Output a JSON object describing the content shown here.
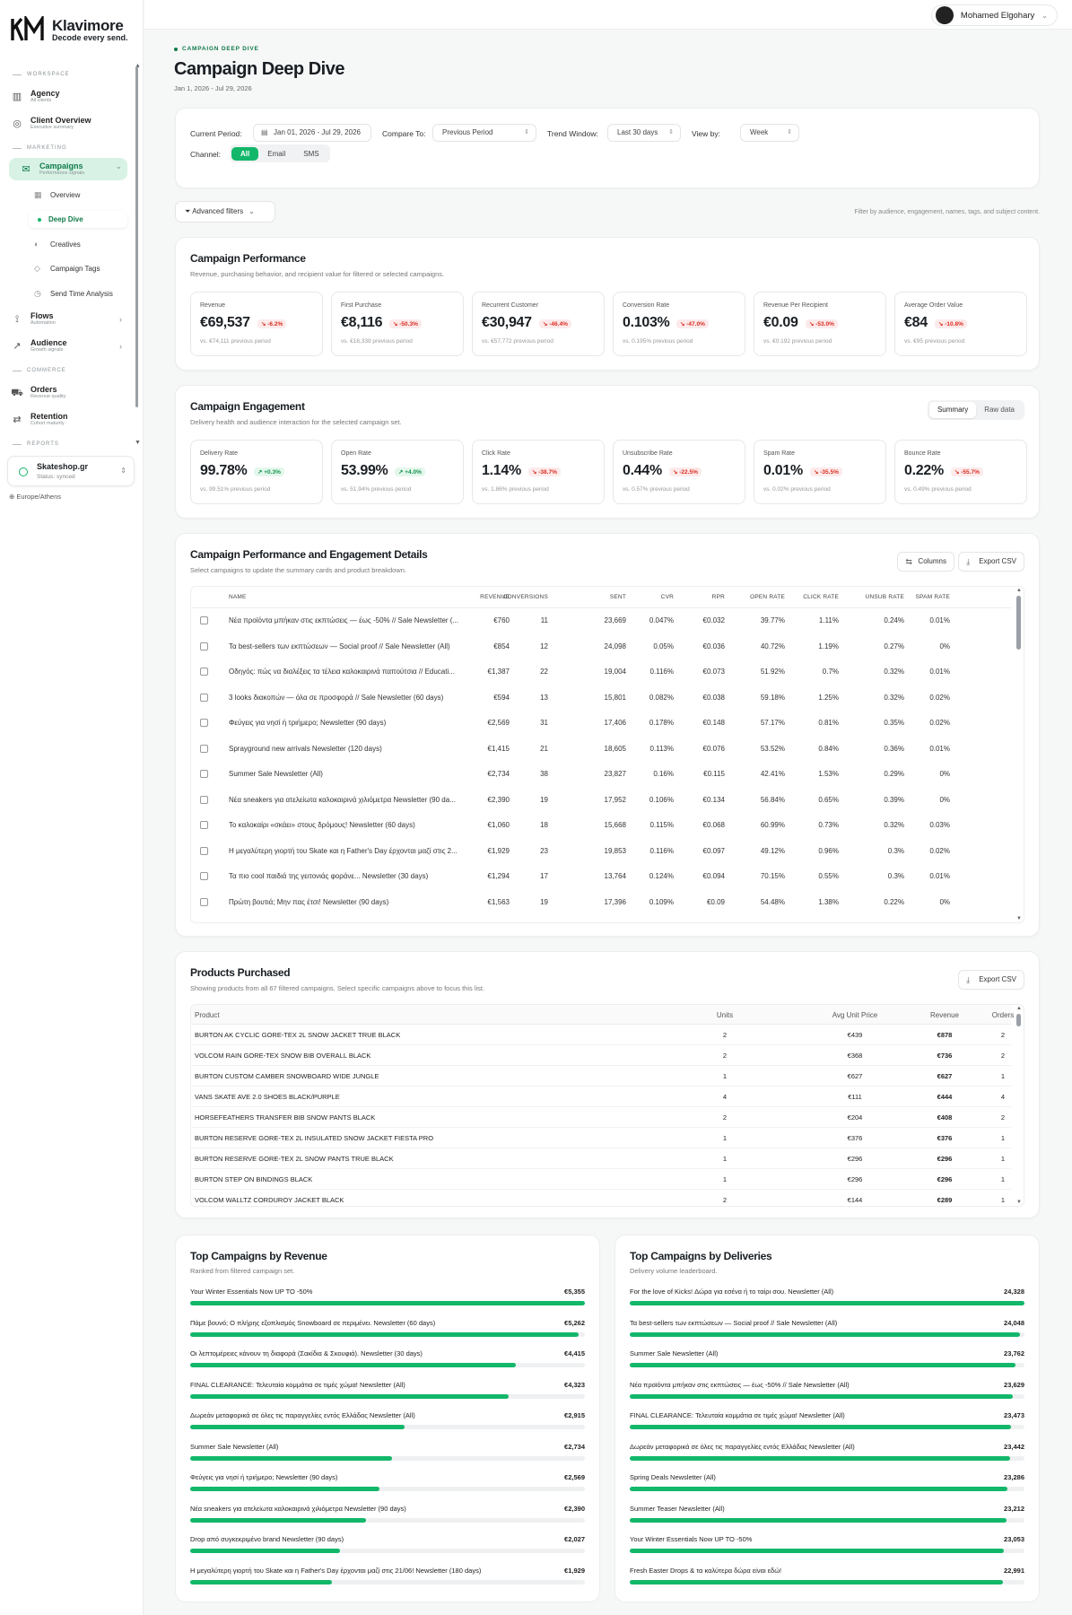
{
  "brand": {
    "name": "Klavimore",
    "tagline": "Decode every send."
  },
  "user": {
    "name": "Mohamed Elgohary"
  },
  "sidebar": {
    "sections": {
      "workspace": "WORKSPACE",
      "marketing": "MARKETING",
      "commerce": "COMMERCE",
      "reports": "REPORTS"
    },
    "items": [
      {
        "label": "Agency",
        "sub": "All clients",
        "icon": "building-icon"
      },
      {
        "label": "Client Overview",
        "sub": "Executive summary",
        "icon": "gauge-icon"
      },
      {
        "label": "Campaigns",
        "sub": "Performance signals",
        "icon": "mail-icon"
      },
      {
        "label": "Flows",
        "sub": "Automation",
        "icon": "flow-icon"
      },
      {
        "label": "Audience",
        "sub": "Growth signals",
        "icon": "trend-icon"
      },
      {
        "label": "Orders",
        "sub": "Revenue quality",
        "icon": "cart-icon"
      },
      {
        "label": "Retention",
        "sub": "Cohort maturity",
        "icon": "repeat-icon"
      }
    ],
    "campaign_subs": [
      "Overview",
      "Deep Dive",
      "Creatives",
      "Campaign Tags",
      "Send Time Analysis"
    ],
    "store": {
      "name": "Skateshop.gr",
      "status": "Status: synced"
    },
    "timezone": "Europe/Athens"
  },
  "page": {
    "eyebrow": "CAMPAIGN DEEP DIVE",
    "title": "Campaign Deep Dive",
    "date_range": "Jan 1, 2026 - Jul 29, 2026"
  },
  "filters": {
    "current_period_label": "Current Period:",
    "current_period": "Jan 01, 2026 - Jul 29, 2026",
    "compare_label": "Compare To:",
    "compare": "Previous Period",
    "trend_label": "Trend Window:",
    "trend": "Last 30 days",
    "view_label": "View by:",
    "view": "Week",
    "channel_label": "Channel:",
    "channels": [
      "All",
      "Email",
      "SMS"
    ],
    "advanced": "Advanced filters",
    "hint": "Filter by audience, engagement, names, tags, and subject content."
  },
  "performance": {
    "title": "Campaign Performance",
    "subtitle": "Revenue, purchasing behavior, and recipient value for filtered or selected campaigns.",
    "kpis": [
      {
        "label": "Revenue",
        "value": "€69,537",
        "delta": "-6.2%",
        "prev": "vs. €74,111 previous period",
        "dir": "neg"
      },
      {
        "label": "First Purchase",
        "value": "€8,116",
        "delta": "-50.3%",
        "prev": "vs. €16,339 previous period",
        "dir": "neg"
      },
      {
        "label": "Recurrent Customer",
        "value": "€30,947",
        "delta": "-46.4%",
        "prev": "vs. €57,772 previous period",
        "dir": "neg"
      },
      {
        "label": "Conversion Rate",
        "value": "0.103%",
        "delta": "-47.0%",
        "prev": "vs. 0.195% previous period",
        "dir": "neg"
      },
      {
        "label": "Revenue Per Recipient",
        "value": "€0.09",
        "delta": "-53.0%",
        "prev": "vs. €0.192 previous period",
        "dir": "neg"
      },
      {
        "label": "Average Order Value",
        "value": "€84",
        "delta": "-10.8%",
        "prev": "vs. €95 previous period",
        "dir": "neg"
      }
    ]
  },
  "engagement": {
    "title": "Campaign Engagement",
    "subtitle": "Delivery health and audience interaction for the selected campaign set.",
    "toggle": [
      "Summary",
      "Raw data"
    ],
    "kpis": [
      {
        "label": "Delivery Rate",
        "value": "99.78%",
        "delta": "+0.3%",
        "prev": "vs. 99.51% previous period",
        "dir": "pos"
      },
      {
        "label": "Open Rate",
        "value": "53.99%",
        "delta": "+4.0%",
        "prev": "vs. 51.94% previous period",
        "dir": "pos"
      },
      {
        "label": "Click Rate",
        "value": "1.14%",
        "delta": "-38.7%",
        "prev": "vs. 1.86% previous period",
        "dir": "neg"
      },
      {
        "label": "Unsubscribe Rate",
        "value": "0.44%",
        "delta": "-22.5%",
        "prev": "vs. 0.57% previous period",
        "dir": "neg"
      },
      {
        "label": "Spam Rate",
        "value": "0.01%",
        "delta": "-35.5%",
        "prev": "vs. 0.02% previous period",
        "dir": "neg"
      },
      {
        "label": "Bounce Rate",
        "value": "0.22%",
        "delta": "-55.7%",
        "prev": "vs. 0.49% previous period",
        "dir": "neg"
      }
    ]
  },
  "details": {
    "title": "Campaign Performance and Engagement Details",
    "subtitle": "Select campaigns to update the summary cards and product breakdown.",
    "columns_btn": "Columns",
    "export_btn": "Export CSV",
    "headers": [
      "NAME",
      "REVENUE",
      "CONVERSIONS",
      "SENT",
      "CVR",
      "RPR",
      "OPEN RATE",
      "CLICK RATE",
      "UNSUB RATE",
      "SPAM RATE"
    ],
    "rows": [
      [
        "Νέα προϊόντα μπήκαν στις εκπτώσεις — έως -50% // Sale Newsletter (...",
        "€760",
        "11",
        "23,669",
        "0.047%",
        "€0.032",
        "39.77%",
        "1.11%",
        "0.24%",
        "0.01%"
      ],
      [
        "Τα best-sellers των εκπτώσεων — Social proof // Sale Newsletter (All)",
        "€854",
        "12",
        "24,098",
        "0.05%",
        "€0.036",
        "40.72%",
        "1.19%",
        "0.27%",
        "0%"
      ],
      [
        "Οδηγός: πώς να διαλέξεις τα τέλεια καλοκαιρινά παπούτσια // Educati...",
        "€1,387",
        "22",
        "19,004",
        "0.116%",
        "€0.073",
        "51.92%",
        "0.7%",
        "0.32%",
        "0.01%"
      ],
      [
        "3 looks διακοπών — όλα σε προσφορά // Sale Newsletter (60 days)",
        "€594",
        "13",
        "15,801",
        "0.082%",
        "€0.038",
        "59.18%",
        "1.25%",
        "0.32%",
        "0.02%"
      ],
      [
        "Φεύγεις για νησί ή τριήμερο; Newsletter (90 days)",
        "€2,569",
        "31",
        "17,406",
        "0.178%",
        "€0.148",
        "57.17%",
        "0.81%",
        "0.35%",
        "0.02%"
      ],
      [
        "Sprayground new arrivals Newsletter (120 days)",
        "€1,415",
        "21",
        "18,605",
        "0.113%",
        "€0.076",
        "53.52%",
        "0.84%",
        "0.36%",
        "0.01%"
      ],
      [
        "Summer Sale Newsletter (All)",
        "€2,734",
        "38",
        "23,827",
        "0.16%",
        "€0.115",
        "42.41%",
        "1.53%",
        "0.29%",
        "0%"
      ],
      [
        "Νέα sneakers για ατελείωτα καλοκαιρινά χιλιόμετρα Newsletter (90 da...",
        "€2,390",
        "19",
        "17,952",
        "0.106%",
        "€0.134",
        "56.84%",
        "0.65%",
        "0.39%",
        "0%"
      ],
      [
        "Το καλοκαίρι «σκάει» στους δρόμους! Newsletter (60 days)",
        "€1,060",
        "18",
        "15,668",
        "0.115%",
        "€0.068",
        "60.99%",
        "0.73%",
        "0.32%",
        "0.03%"
      ],
      [
        "Η μεγαλύτερη γιορτή του Skate και η Father's Day έρχονται μαζί στις 2...",
        "€1,929",
        "23",
        "19,853",
        "0.116%",
        "€0.097",
        "49.12%",
        "0.96%",
        "0.3%",
        "0.02%"
      ],
      [
        "Τα πιο cool παιδιά της γειτονιάς φοράνε... Newsletter (30 days)",
        "€1,294",
        "17",
        "13,764",
        "0.124%",
        "€0.094",
        "70.15%",
        "0.55%",
        "0.3%",
        "0.01%"
      ],
      [
        "Πρώτη βουτιά; Μην πας έτσι! Newsletter (90 days)",
        "€1,563",
        "19",
        "17,396",
        "0.109%",
        "€0.09",
        "54.48%",
        "1.38%",
        "0.22%",
        "0%"
      ]
    ]
  },
  "products": {
    "title": "Products Purchased",
    "subtitle": "Showing products from all 67 filtered campaigns. Select specific campaigns above to focus this list.",
    "export_btn": "Export CSV",
    "headers": [
      "Product",
      "Units",
      "Avg Unit Price",
      "Revenue",
      "Orders"
    ],
    "rows": [
      [
        "BURTON AK CYCLIC GORE-TEX 2L SNOW JACKET TRUE BLACK",
        "2",
        "€439",
        "€878",
        "2"
      ],
      [
        "VOLCOM RAIN GORE-TEX SNOW BIB OVERALL BLACK",
        "2",
        "€368",
        "€736",
        "2"
      ],
      [
        "BURTON CUSTOM CAMBER SNOWBOARD WIDE JUNGLE",
        "1",
        "€627",
        "€627",
        "1"
      ],
      [
        "VANS SKATE AVE 2.0 SHOES BLACK/PURPLE",
        "4",
        "€111",
        "€444",
        "4"
      ],
      [
        "HORSEFEATHERS TRANSFER BIB SNOW PANTS BLACK",
        "2",
        "€204",
        "€408",
        "2"
      ],
      [
        "BURTON RESERVE GORE-TEX 2L INSULATED SNOW JACKET FIESTA PRO",
        "1",
        "€376",
        "€376",
        "1"
      ],
      [
        "BURTON RESERVE GORE-TEX 2L SNOW PANTS TRUE BLACK",
        "1",
        "€296",
        "€296",
        "1"
      ],
      [
        "BURTON STEP ON BINDINGS BLACK",
        "1",
        "€296",
        "€296",
        "1"
      ],
      [
        "VOLCOM WALLTZ CORDUROY JACKET BLACK",
        "2",
        "€144",
        "€289",
        "1"
      ]
    ]
  },
  "top_revenue": {
    "title": "Top Campaigns by Revenue",
    "subtitle": "Ranked from filtered campaign set.",
    "items": [
      {
        "label": "Your Winter Essentials Now UP TO -50%",
        "value": "€5,355",
        "frac": 1.0
      },
      {
        "label": "Πάμε βουνό; Ο πλήρης εξοπλισμός Snowboard σε περιμένει. Newsletter (60 days)",
        "value": "€5,262",
        "frac": 0.983
      },
      {
        "label": "Οι λεπτομέρειες κάνουν τη διαφορά (Σακίδια & Σκουφιά). Newsletter (30 days)",
        "value": "€4,415",
        "frac": 0.824
      },
      {
        "label": "FINAL CLEARANCE: Τελευταία κομμάτια σε τιμές χώμα! Newsletter (All)",
        "value": "€4,323",
        "frac": 0.807
      },
      {
        "label": "Δωρεάν μεταφορικά σε όλες τις παραγγελίες εντός Ελλάδας Newsletter (All)",
        "value": "€2,915",
        "frac": 0.544
      },
      {
        "label": "Summer Sale Newsletter (All)",
        "value": "€2,734",
        "frac": 0.511
      },
      {
        "label": "Φεύγεις για νησί ή τριήμερο; Newsletter (90 days)",
        "value": "€2,569",
        "frac": 0.48
      },
      {
        "label": "Νέα sneakers για ατελείωτα καλοκαιρινά χιλιόμετρα Newsletter (90 days)",
        "value": "€2,390",
        "frac": 0.446
      },
      {
        "label": "Drop από συγκεκριμένο brand Newsletter (90 days)",
        "value": "€2,027",
        "frac": 0.379
      },
      {
        "label": "Η μεγαλύτερη γιορτή του Skate και η Father's Day έρχονται μαζί στις 21/06! Newsletter (180 days)",
        "value": "€1,929",
        "frac": 0.36
      }
    ]
  },
  "top_deliveries": {
    "title": "Top Campaigns by Deliveries",
    "subtitle": "Delivery volume leaderboard.",
    "items": [
      {
        "label": "For the love of Kicks! Δώρα για εσένα ή το ταίρι σου. Newsletter (All)",
        "value": "24,328",
        "frac": 1.0
      },
      {
        "label": "Τα best-sellers των εκπτώσεων — Social proof // Sale Newsletter (All)",
        "value": "24,048",
        "frac": 0.988
      },
      {
        "label": "Summer Sale Newsletter (All)",
        "value": "23,762",
        "frac": 0.977
      },
      {
        "label": "Νέα προϊόντα μπήκαν στις εκπτώσεις — έως -50% // Sale Newsletter (All)",
        "value": "23,629",
        "frac": 0.971
      },
      {
        "label": "FINAL CLEARANCE: Τελευταία κομμάτια σε τιμές χώμα! Newsletter (All)",
        "value": "23,473",
        "frac": 0.965
      },
      {
        "label": "Δωρεάν μεταφορικά σε όλες τις παραγγελίες εντός Ελλάδας Newsletter (All)",
        "value": "23,442",
        "frac": 0.964
      },
      {
        "label": "Spring Deals Newsletter (All)",
        "value": "23,286",
        "frac": 0.957
      },
      {
        "label": "Summer Teaser Newsletter (All)",
        "value": "23,212",
        "frac": 0.954
      },
      {
        "label": "Your Winter Essentials Now UP TO -50%",
        "value": "23,053",
        "frac": 0.948
      },
      {
        "label": "Fresh Easter Drops & τα καλύτερα δώρα είναι εδώ!",
        "value": "22,991",
        "frac": 0.945
      }
    ]
  },
  "colors": {
    "accent": "#12b76a",
    "accent_dark": "#0f7a4a",
    "negative": "#d92d20",
    "positive": "#12924c"
  }
}
